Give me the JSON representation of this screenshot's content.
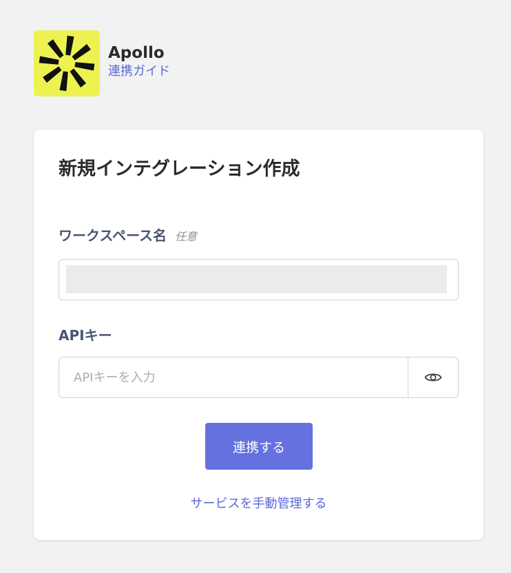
{
  "app": {
    "name": "Apollo",
    "guide_link": "連携ガイド",
    "logo_bg": "#eef251",
    "logo_icon": "asterisk-burst-icon"
  },
  "form": {
    "title": "新規インテグレーション作成",
    "workspace_label": "ワークスペース名",
    "workspace_optional": "任意",
    "workspace_value": "",
    "api_key_label": "APIキー",
    "api_key_placeholder": "APIキーを入力",
    "api_key_value": "",
    "visibility_icon": "eye-icon",
    "submit_label": "連携する",
    "manual_link": "サービスを手動管理する"
  },
  "colors": {
    "accent": "#6571de",
    "link": "#5b67d8",
    "label": "#4a5475",
    "page_bg": "#f2f2f3"
  }
}
